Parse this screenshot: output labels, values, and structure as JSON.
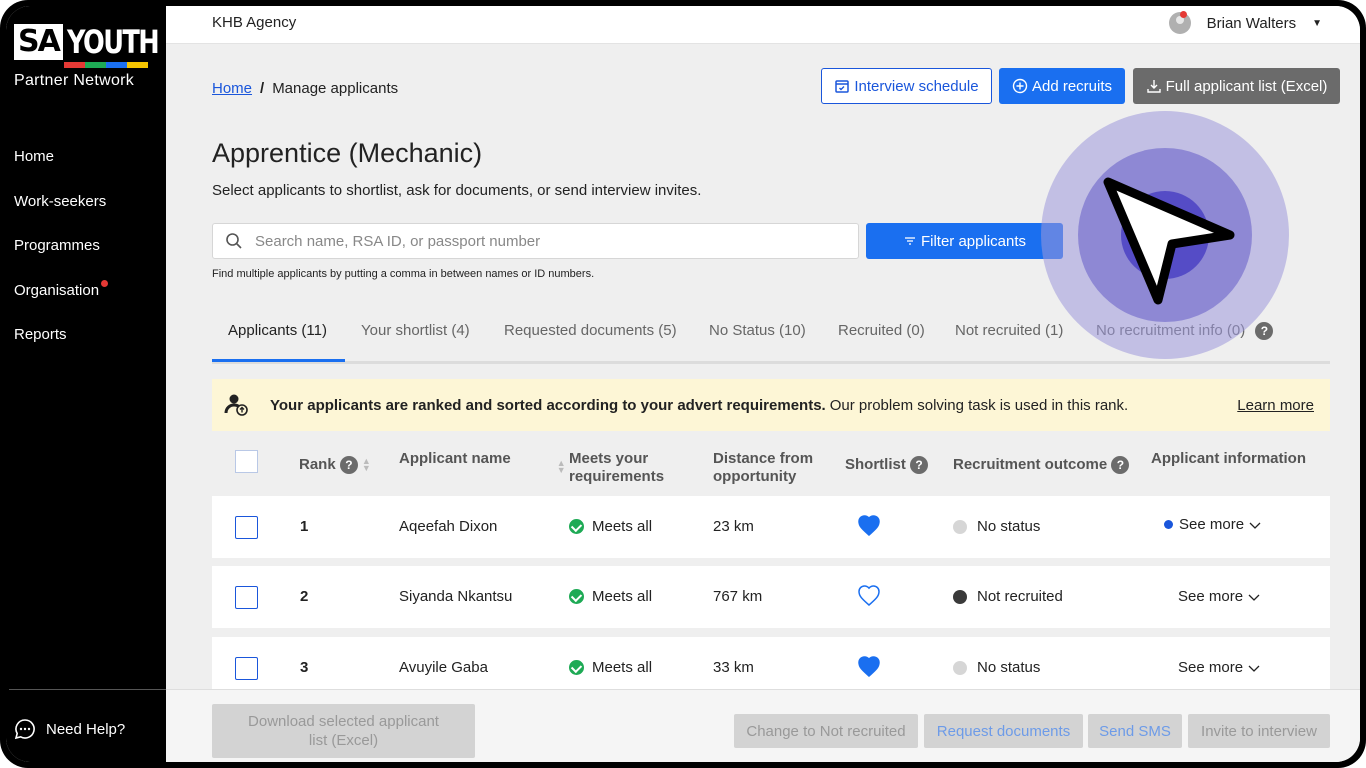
{
  "brand": {
    "logo_sa": "SA",
    "logo_youth": "YOUTH",
    "logo_sub": "Partner Network"
  },
  "sidebar": {
    "items": [
      {
        "label": "Home"
      },
      {
        "label": "Work-seekers"
      },
      {
        "label": "Programmes"
      },
      {
        "label": "Organisation"
      },
      {
        "label": "Reports"
      }
    ],
    "help_label": "Need Help?"
  },
  "topbar": {
    "agency": "KHB Agency",
    "user_name": "Brian Walters"
  },
  "breadcrumb": {
    "home": "Home",
    "separator": "/",
    "current": "Manage applicants"
  },
  "actions": {
    "interview_schedule": "Interview schedule",
    "add_recruits": "Add recruits",
    "full_list": "Full applicant list (Excel)"
  },
  "page": {
    "title": "Apprentice (Mechanic)",
    "subtitle": "Select applicants to shortlist, ask for documents, or send interview invites."
  },
  "search": {
    "placeholder": "Search name, RSA ID, or passport number",
    "filter_label": "Filter applicants",
    "hint": "Find multiple applicants by putting a comma in between names or ID numbers."
  },
  "tabs": [
    {
      "label": "Applicants (11)",
      "active": true
    },
    {
      "label": "Your shortlist (4)"
    },
    {
      "label": "Requested documents (5)"
    },
    {
      "label": "No Status (10)"
    },
    {
      "label": "Recruited (0)"
    },
    {
      "label": "Not recruited (1)"
    },
    {
      "label": "No recruitment info (0)"
    }
  ],
  "banner": {
    "bold": "Your applicants are ranked and sorted according to your advert requirements.",
    "text": "Our problem solving task is used in this rank.",
    "link": "Learn more"
  },
  "table": {
    "headers": {
      "rank": "Rank",
      "name": "Applicant name",
      "meets_1": "Meets your",
      "meets_2": "requirements",
      "distance_1": "Distance from",
      "distance_2": "opportunity",
      "shortlist": "Shortlist",
      "outcome": "Recruitment outcome",
      "info": "Applicant information"
    },
    "rows": [
      {
        "rank": "1",
        "name": "Aqeefah Dixon",
        "meets": "Meets all",
        "distance": "23 km",
        "shortlisted": true,
        "status": "No status",
        "status_color": "#d6d6d6",
        "info": "See more",
        "new": true
      },
      {
        "rank": "2",
        "name": "Siyanda Nkantsu",
        "meets": "Meets all",
        "distance": "767 km",
        "shortlisted": false,
        "status": "Not recruited",
        "status_color": "#3a3a3a",
        "info": "See more",
        "new": false
      },
      {
        "rank": "3",
        "name": "Avuyile Gaba",
        "meets": "Meets all",
        "distance": "33 km",
        "shortlisted": true,
        "status": "No status",
        "status_color": "#d6d6d6",
        "info": "See more",
        "new": false
      }
    ]
  },
  "bottom": {
    "download": "Download selected applicant list (Excel)",
    "not_recruited": "Change to Not recruited",
    "request_docs": "Request documents",
    "send_sms": "Send SMS",
    "invite": "Invite to interview"
  },
  "colors": {
    "accent": "#1a6ff0",
    "link": "#1a56db",
    "success": "#1eaa55",
    "banner": "#fdf6d6",
    "alert_dot": "#e53935"
  },
  "icons": [
    "search-icon",
    "calendar-icon",
    "plus-circle-icon",
    "download-icon",
    "filter-icon",
    "user-icon",
    "chat-icon",
    "heart-icon",
    "chevron-down-icon",
    "question-icon",
    "cursor-icon"
  ]
}
